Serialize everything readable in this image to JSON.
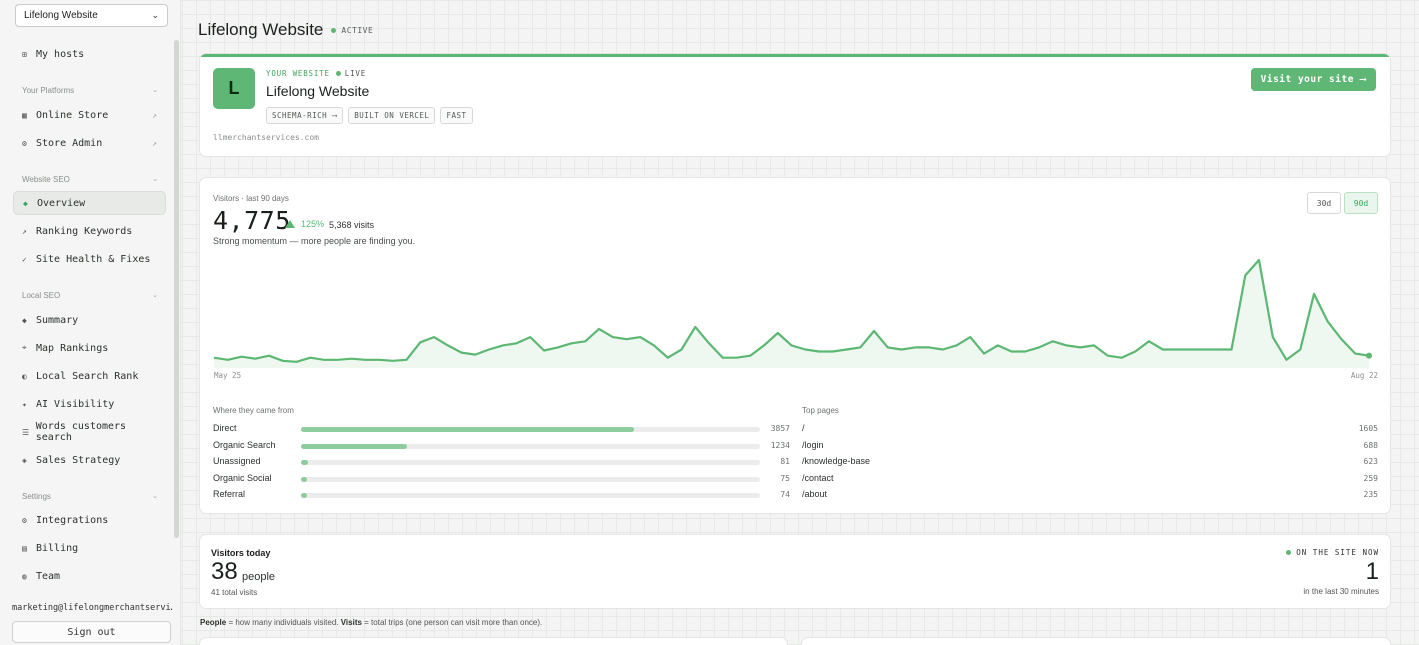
{
  "sidebar": {
    "site_select": "Lifelong Website",
    "my_hosts": "My hosts",
    "sections": {
      "platforms": "Your Platforms",
      "website_seo": "Website SEO",
      "local_seo": "Local SEO",
      "settings": "Settings"
    },
    "items": {
      "online_store": "Online Store",
      "store_admin": "Store Admin",
      "overview": "Overview",
      "ranking_keywords": "Ranking Keywords",
      "site_health": "Site Health & Fixes",
      "summary": "Summary",
      "map_rankings": "Map Rankings",
      "local_search_rank": "Local Search Rank",
      "ai_visibility": "AI Visibility",
      "words_customers": "Words customers search",
      "sales_strategy": "Sales Strategy",
      "integrations": "Integrations",
      "billing": "Billing",
      "team": "Team"
    },
    "user_email": "marketing@lifelongmerchantservi…",
    "sign_out": "Sign out"
  },
  "header": {
    "title": "Lifelong Website",
    "status": "ACTIVE"
  },
  "website_card": {
    "avatar_letter": "L",
    "eyebrow": "YOUR WEBSITE",
    "live": "LIVE",
    "name": "Lifelong Website",
    "tags": [
      "SCHEMA-RICH ⟶",
      "BUILT ON VERCEL",
      "FAST"
    ],
    "domain": "llmerchantservices.com",
    "visit_button": "Visit your site ⟶"
  },
  "visitors_card": {
    "label": "Visitors · last 90 days",
    "total": "4,775",
    "trend": "125%",
    "visits": "5,368 visits",
    "subtitle": "Strong momentum — more people are finding you.",
    "range_30": "30d",
    "range_90": "90d",
    "sources_title": "Where they came from",
    "sources": [
      {
        "name": "Direct",
        "value": "3857",
        "fraction": 0.725
      },
      {
        "name": "Organic Search",
        "value": "1234",
        "fraction": 0.232
      },
      {
        "name": "Unassigned",
        "value": "81",
        "fraction": 0.015
      },
      {
        "name": "Organic Social",
        "value": "75",
        "fraction": 0.014
      },
      {
        "name": "Referral",
        "value": "74",
        "fraction": 0.014
      }
    ],
    "pages_title": "Top pages",
    "pages": [
      {
        "path": "/",
        "value": "1605"
      },
      {
        "path": "/login",
        "value": "688"
      },
      {
        "path": "/knowledge-base",
        "value": "623"
      },
      {
        "path": "/contact",
        "value": "259"
      },
      {
        "path": "/about",
        "value": "235"
      }
    ]
  },
  "chart_data": {
    "type": "area",
    "x_start_label": "May 25",
    "x_end_label": "Aug 22",
    "values": [
      10,
      8,
      11,
      9,
      12,
      7,
      6,
      10,
      8,
      8,
      9,
      8,
      8,
      7,
      8,
      25,
      30,
      22,
      15,
      13,
      18,
      22,
      24,
      30,
      17,
      20,
      24,
      26,
      38,
      30,
      28,
      30,
      22,
      10,
      18,
      40,
      24,
      10,
      10,
      12,
      22,
      34,
      22,
      18,
      16,
      16,
      18,
      20,
      36,
      20,
      18,
      20,
      20,
      18,
      22,
      30,
      14,
      22,
      16,
      16,
      20,
      26,
      22,
      20,
      22,
      12,
      10,
      16,
      26,
      18,
      18,
      18,
      18,
      18,
      18,
      90,
      105,
      30,
      8,
      18,
      72,
      45,
      28,
      14,
      12
    ]
  },
  "today_card": {
    "label": "Visitors today",
    "people_count": "38",
    "people_word": "people",
    "total_visits": "41 total visits",
    "on_site_label": "ON THE SITE NOW",
    "on_site_count": "1",
    "on_site_sub": "in the last 30 minutes"
  },
  "footnote": {
    "people_term": "People",
    "people_def": " = how many individuals visited. ",
    "visits_term": "Visits",
    "visits_def": " = total trips (one person can visit more than once)."
  },
  "colors": {
    "accent": "#5cb773",
    "accent_fill": "#8dcc9c"
  }
}
